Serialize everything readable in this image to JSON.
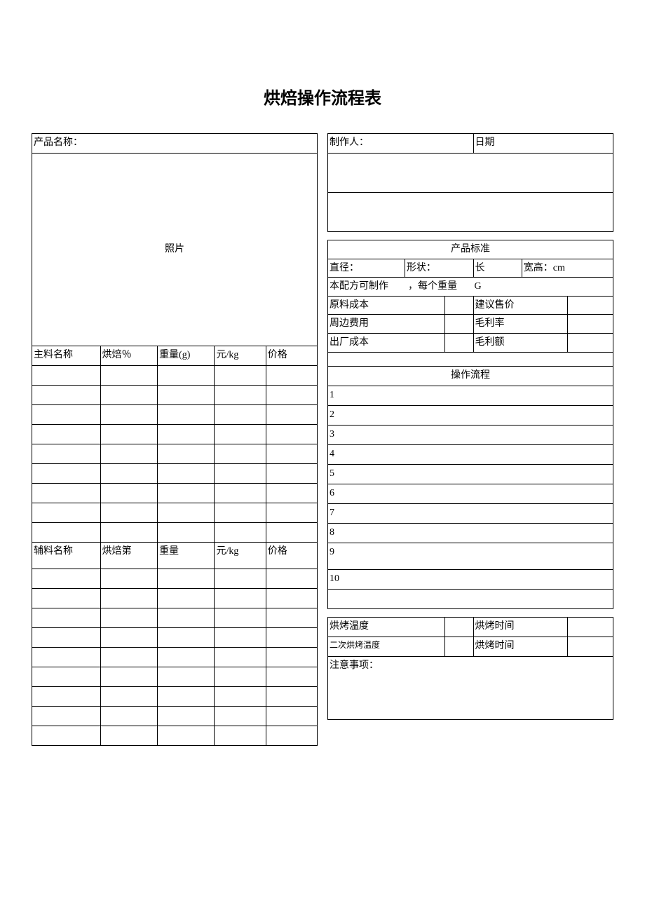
{
  "title": "烘焙操作流程表",
  "left": {
    "product_name_label": "产品名称：",
    "photo_label": "照片",
    "main_headers": [
      "主料名称",
      "烘焙％",
      "重量(g)",
      "元/kg",
      "价格"
    ],
    "aux_headers": [
      "辅料名称",
      "烘焙第",
      "重量",
      "元/kg",
      "价格"
    ]
  },
  "right": {
    "producer_label": "制作人：",
    "date_label": "日期",
    "standard_header": "产品标准",
    "diameter_label": "直径：",
    "shape_label": "形状：",
    "length_label": "长",
    "width_label": "宽高：cm",
    "recipe_prefix": "本配方可制作",
    "recipe_mid": "，每个重量",
    "recipe_suffix": "G",
    "raw_cost_label": "原料成本",
    "suggest_price_label": "建议售价",
    "periph_cost_label": "周边费用",
    "gross_rate_label": "毛利率",
    "factory_cost_label": "出厂成本",
    "gross_amount_label": "毛利额",
    "process_header": "操作流程",
    "steps": [
      "1",
      "2",
      "3",
      "4",
      "5",
      "6",
      "7",
      "8",
      "9",
      "10"
    ],
    "bake_temp_label": "烘烤温度",
    "bake_time_label": "烘烤时间",
    "second_bake_temp_label": "二次烘烤温度",
    "second_bake_time_label": "烘烤时间",
    "notes_label": "注意事项："
  }
}
